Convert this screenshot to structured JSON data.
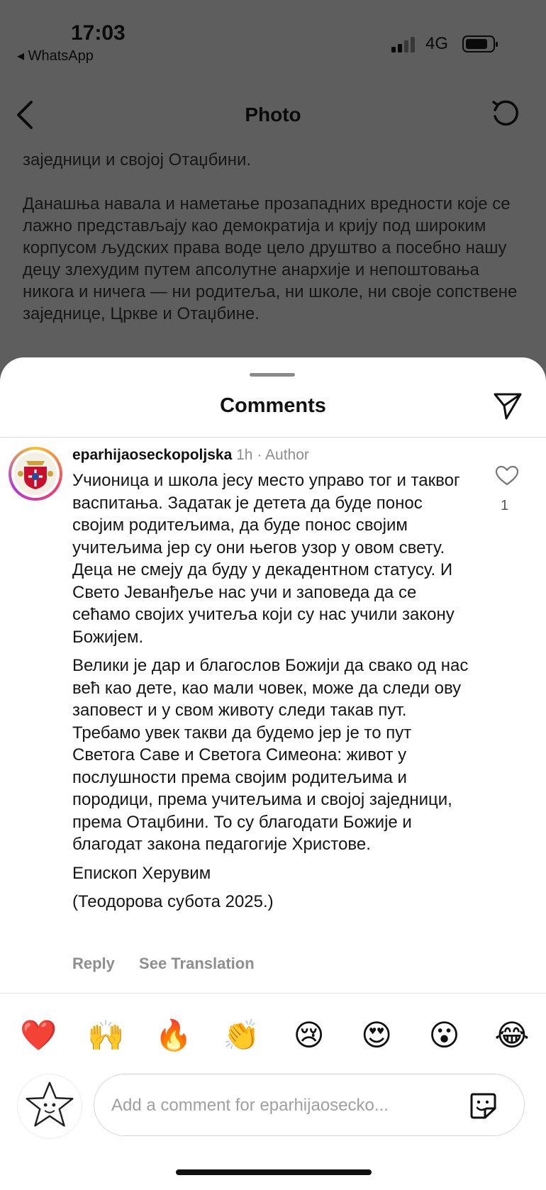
{
  "status_bar": {
    "time": "17:03",
    "back_app": "◂ WhatsApp",
    "network": "4G"
  },
  "topbar": {
    "title": "Photo"
  },
  "photo_text": {
    "paragraphs": [
      "заједници и својој Отаџбини.",
      "Данашња навала и наметање прозападних вредности које се лажно представљају као демократија и крију под широким корпусом људских права воде цело друштво а посебно нашу децу злехудим путем апсолутне анархије и непоштовања никога и ничега — ни родитеља, ни школе, ни своје сопствене заједнице, Цркве и Отаџбине."
    ]
  },
  "comments_sheet": {
    "title": "Comments",
    "comment": {
      "username": "eparhijaoseckopoljska",
      "age": "1h",
      "separator": "·",
      "author_badge": "Author",
      "paragraphs": [
        "Учионица и школа јесу место управо тог и таквог васпитања. Задатак је детета да буде понос својим родитељима, да буде понос својим учитељима јер су они његов узор у овом свету. Деца не смеју да буду у декадентном статусу. И Свето Јеванђеље нас учи и заповеда да се сећамо својих учитеља који су нас учили закону Божијем.",
        "Велики је дар и благослов Божији да свако од нас већ као дете, као мали човек, може да следи ову заповест и у свом животу следи такав пут. Требамо увек такви да будемо јер је то пут Светога Саве и Светога Симеона: живот у послушности према својим родитељима и породици, према учитељима и својој заједници, према Отаџбини. То су благодати Божије и благодат закона педагогије Христове.",
        "Епископ Херувим",
        "(Теодорова субота 2025.)"
      ],
      "like_count": "1",
      "reply_label": "Reply",
      "translate_label": "See Translation"
    },
    "reactions": [
      "❤️",
      "🙌",
      "🔥",
      "👏",
      "😢",
      "😍",
      "😮",
      "😂"
    ],
    "input": {
      "placeholder": "Add a comment for eparhijaosecko..."
    }
  },
  "colors": {
    "overlay": "#5e5e5e",
    "sheet": "#ffffff",
    "muted_text": "#8e8e8e"
  },
  "icons": [
    "back-chevron-icon",
    "refresh-icon",
    "send-icon",
    "heart-icon",
    "sticker-icon"
  ]
}
